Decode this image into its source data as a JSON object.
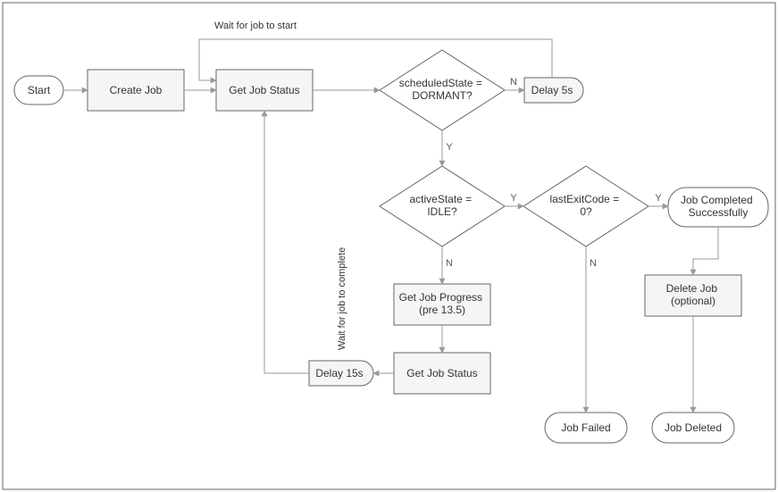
{
  "nodes": {
    "start": "Start",
    "create_job": "Create Job",
    "get_status_1": "Get Job Status",
    "decision_scheduled": [
      "scheduledState =",
      "DORMANT?"
    ],
    "delay5": "Delay 5s",
    "decision_active": [
      "activeState =",
      "IDLE?"
    ],
    "decision_exit": [
      "lastExitCode =",
      "0?"
    ],
    "completed": [
      "Job Completed",
      "Successfully"
    ],
    "get_progress": [
      "Get Job Progress",
      "(pre 13.5)"
    ],
    "get_status_2": "Get Job Status",
    "delay15": "Delay 15s",
    "delete_job": [
      "Delete Job",
      "(optional)"
    ],
    "job_failed": "Job Failed",
    "job_deleted": "Job Deleted"
  },
  "edge_labels": {
    "N": "N",
    "Y": "Y"
  },
  "annotations": {
    "wait_start": "Wait for job to start",
    "wait_complete": "Wait for job to complete"
  },
  "chart_data": {
    "type": "flowchart",
    "title": "",
    "nodes": [
      {
        "id": "start",
        "type": "terminator",
        "label": "Start"
      },
      {
        "id": "create_job",
        "type": "process",
        "label": "Create Job"
      },
      {
        "id": "get_status_1",
        "type": "process",
        "label": "Get Job Status"
      },
      {
        "id": "decision_scheduled",
        "type": "decision",
        "label": "scheduledState = DORMANT?"
      },
      {
        "id": "delay5",
        "type": "delay",
        "label": "Delay 5s"
      },
      {
        "id": "decision_active",
        "type": "decision",
        "label": "activeState = IDLE?"
      },
      {
        "id": "decision_exit",
        "type": "decision",
        "label": "lastExitCode = 0?"
      },
      {
        "id": "completed",
        "type": "terminator",
        "label": "Job Completed Successfully"
      },
      {
        "id": "get_progress",
        "type": "process",
        "label": "Get Job Progress (pre 13.5)"
      },
      {
        "id": "get_status_2",
        "type": "process",
        "label": "Get Job Status"
      },
      {
        "id": "delay15",
        "type": "delay",
        "label": "Delay 15s"
      },
      {
        "id": "delete_job",
        "type": "process",
        "label": "Delete Job (optional)"
      },
      {
        "id": "job_failed",
        "type": "terminator",
        "label": "Job Failed"
      },
      {
        "id": "job_deleted",
        "type": "terminator",
        "label": "Job Deleted"
      }
    ],
    "edges": [
      {
        "from": "start",
        "to": "create_job"
      },
      {
        "from": "create_job",
        "to": "get_status_1"
      },
      {
        "from": "get_status_1",
        "to": "decision_scheduled"
      },
      {
        "from": "decision_scheduled",
        "to": "delay5",
        "label": "N"
      },
      {
        "from": "delay5",
        "to": "get_status_1",
        "annotation": "Wait for job to start"
      },
      {
        "from": "decision_scheduled",
        "to": "decision_active",
        "label": "Y"
      },
      {
        "from": "decision_active",
        "to": "decision_exit",
        "label": "Y"
      },
      {
        "from": "decision_active",
        "to": "get_progress",
        "label": "N"
      },
      {
        "from": "get_progress",
        "to": "get_status_2"
      },
      {
        "from": "get_status_2",
        "to": "delay15"
      },
      {
        "from": "delay15",
        "to": "get_status_1",
        "annotation": "Wait for job to complete"
      },
      {
        "from": "decision_exit",
        "to": "completed",
        "label": "Y"
      },
      {
        "from": "decision_exit",
        "to": "job_failed",
        "label": "N"
      },
      {
        "from": "completed",
        "to": "delete_job"
      },
      {
        "from": "delete_job",
        "to": "job_deleted"
      }
    ]
  }
}
